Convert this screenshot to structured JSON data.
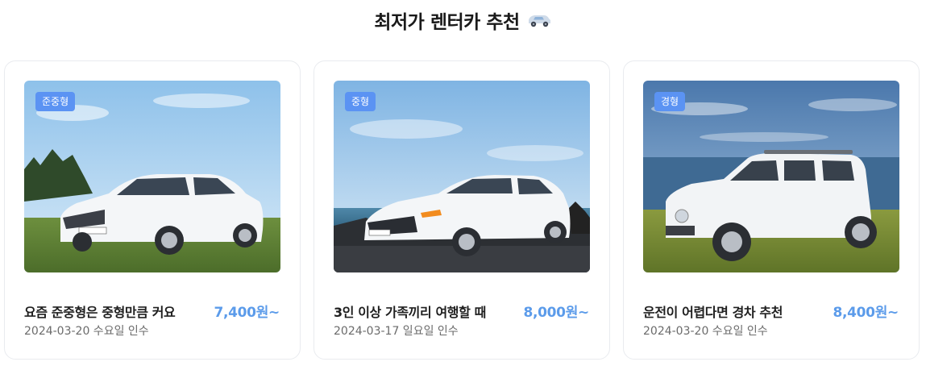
{
  "section": {
    "title": "최저가 렌터카 추천",
    "icon": "car-icon"
  },
  "colors": {
    "badge": "#5b93f3",
    "price": "#5b9bea",
    "card_border": "#e9ebef"
  },
  "cards": [
    {
      "badge": "준중형",
      "title": "요즘 준중형은 중형만큼 커요",
      "price": "7,400원~",
      "date": "2024-03-20 수요일 인수",
      "image": "white-sedan-on-grass-photo"
    },
    {
      "badge": "중형",
      "title": "3인 이상 가족끼리 여행할 때",
      "price": "8,000원~",
      "date": "2024-03-17 일요일 인수",
      "image": "white-sedan-by-sea-photo"
    },
    {
      "badge": "경형",
      "title": "운전이 어렵다면 경차 추천",
      "price": "8,400원~",
      "date": "2024-03-20 수요일 인수",
      "image": "white-compact-suv-photo"
    }
  ]
}
